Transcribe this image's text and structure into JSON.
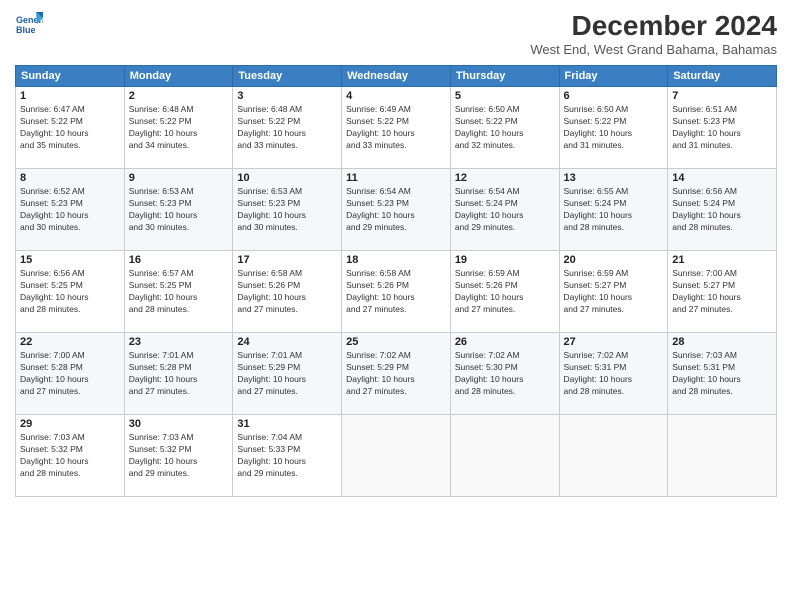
{
  "header": {
    "logo_line1": "General",
    "logo_line2": "Blue",
    "title": "December 2024",
    "subtitle": "West End, West Grand Bahama, Bahamas"
  },
  "weekdays": [
    "Sunday",
    "Monday",
    "Tuesday",
    "Wednesday",
    "Thursday",
    "Friday",
    "Saturday"
  ],
  "weeks": [
    [
      {
        "day": "1",
        "info": "Sunrise: 6:47 AM\nSunset: 5:22 PM\nDaylight: 10 hours\nand 35 minutes."
      },
      {
        "day": "2",
        "info": "Sunrise: 6:48 AM\nSunset: 5:22 PM\nDaylight: 10 hours\nand 34 minutes."
      },
      {
        "day": "3",
        "info": "Sunrise: 6:48 AM\nSunset: 5:22 PM\nDaylight: 10 hours\nand 33 minutes."
      },
      {
        "day": "4",
        "info": "Sunrise: 6:49 AM\nSunset: 5:22 PM\nDaylight: 10 hours\nand 33 minutes."
      },
      {
        "day": "5",
        "info": "Sunrise: 6:50 AM\nSunset: 5:22 PM\nDaylight: 10 hours\nand 32 minutes."
      },
      {
        "day": "6",
        "info": "Sunrise: 6:50 AM\nSunset: 5:22 PM\nDaylight: 10 hours\nand 31 minutes."
      },
      {
        "day": "7",
        "info": "Sunrise: 6:51 AM\nSunset: 5:23 PM\nDaylight: 10 hours\nand 31 minutes."
      }
    ],
    [
      {
        "day": "8",
        "info": "Sunrise: 6:52 AM\nSunset: 5:23 PM\nDaylight: 10 hours\nand 30 minutes."
      },
      {
        "day": "9",
        "info": "Sunrise: 6:53 AM\nSunset: 5:23 PM\nDaylight: 10 hours\nand 30 minutes."
      },
      {
        "day": "10",
        "info": "Sunrise: 6:53 AM\nSunset: 5:23 PM\nDaylight: 10 hours\nand 30 minutes."
      },
      {
        "day": "11",
        "info": "Sunrise: 6:54 AM\nSunset: 5:23 PM\nDaylight: 10 hours\nand 29 minutes."
      },
      {
        "day": "12",
        "info": "Sunrise: 6:54 AM\nSunset: 5:24 PM\nDaylight: 10 hours\nand 29 minutes."
      },
      {
        "day": "13",
        "info": "Sunrise: 6:55 AM\nSunset: 5:24 PM\nDaylight: 10 hours\nand 28 minutes."
      },
      {
        "day": "14",
        "info": "Sunrise: 6:56 AM\nSunset: 5:24 PM\nDaylight: 10 hours\nand 28 minutes."
      }
    ],
    [
      {
        "day": "15",
        "info": "Sunrise: 6:56 AM\nSunset: 5:25 PM\nDaylight: 10 hours\nand 28 minutes."
      },
      {
        "day": "16",
        "info": "Sunrise: 6:57 AM\nSunset: 5:25 PM\nDaylight: 10 hours\nand 28 minutes."
      },
      {
        "day": "17",
        "info": "Sunrise: 6:58 AM\nSunset: 5:26 PM\nDaylight: 10 hours\nand 27 minutes."
      },
      {
        "day": "18",
        "info": "Sunrise: 6:58 AM\nSunset: 5:26 PM\nDaylight: 10 hours\nand 27 minutes."
      },
      {
        "day": "19",
        "info": "Sunrise: 6:59 AM\nSunset: 5:26 PM\nDaylight: 10 hours\nand 27 minutes."
      },
      {
        "day": "20",
        "info": "Sunrise: 6:59 AM\nSunset: 5:27 PM\nDaylight: 10 hours\nand 27 minutes."
      },
      {
        "day": "21",
        "info": "Sunrise: 7:00 AM\nSunset: 5:27 PM\nDaylight: 10 hours\nand 27 minutes."
      }
    ],
    [
      {
        "day": "22",
        "info": "Sunrise: 7:00 AM\nSunset: 5:28 PM\nDaylight: 10 hours\nand 27 minutes."
      },
      {
        "day": "23",
        "info": "Sunrise: 7:01 AM\nSunset: 5:28 PM\nDaylight: 10 hours\nand 27 minutes."
      },
      {
        "day": "24",
        "info": "Sunrise: 7:01 AM\nSunset: 5:29 PM\nDaylight: 10 hours\nand 27 minutes."
      },
      {
        "day": "25",
        "info": "Sunrise: 7:02 AM\nSunset: 5:29 PM\nDaylight: 10 hours\nand 27 minutes."
      },
      {
        "day": "26",
        "info": "Sunrise: 7:02 AM\nSunset: 5:30 PM\nDaylight: 10 hours\nand 28 minutes."
      },
      {
        "day": "27",
        "info": "Sunrise: 7:02 AM\nSunset: 5:31 PM\nDaylight: 10 hours\nand 28 minutes."
      },
      {
        "day": "28",
        "info": "Sunrise: 7:03 AM\nSunset: 5:31 PM\nDaylight: 10 hours\nand 28 minutes."
      }
    ],
    [
      {
        "day": "29",
        "info": "Sunrise: 7:03 AM\nSunset: 5:32 PM\nDaylight: 10 hours\nand 28 minutes."
      },
      {
        "day": "30",
        "info": "Sunrise: 7:03 AM\nSunset: 5:32 PM\nDaylight: 10 hours\nand 29 minutes."
      },
      {
        "day": "31",
        "info": "Sunrise: 7:04 AM\nSunset: 5:33 PM\nDaylight: 10 hours\nand 29 minutes."
      },
      null,
      null,
      null,
      null
    ]
  ]
}
